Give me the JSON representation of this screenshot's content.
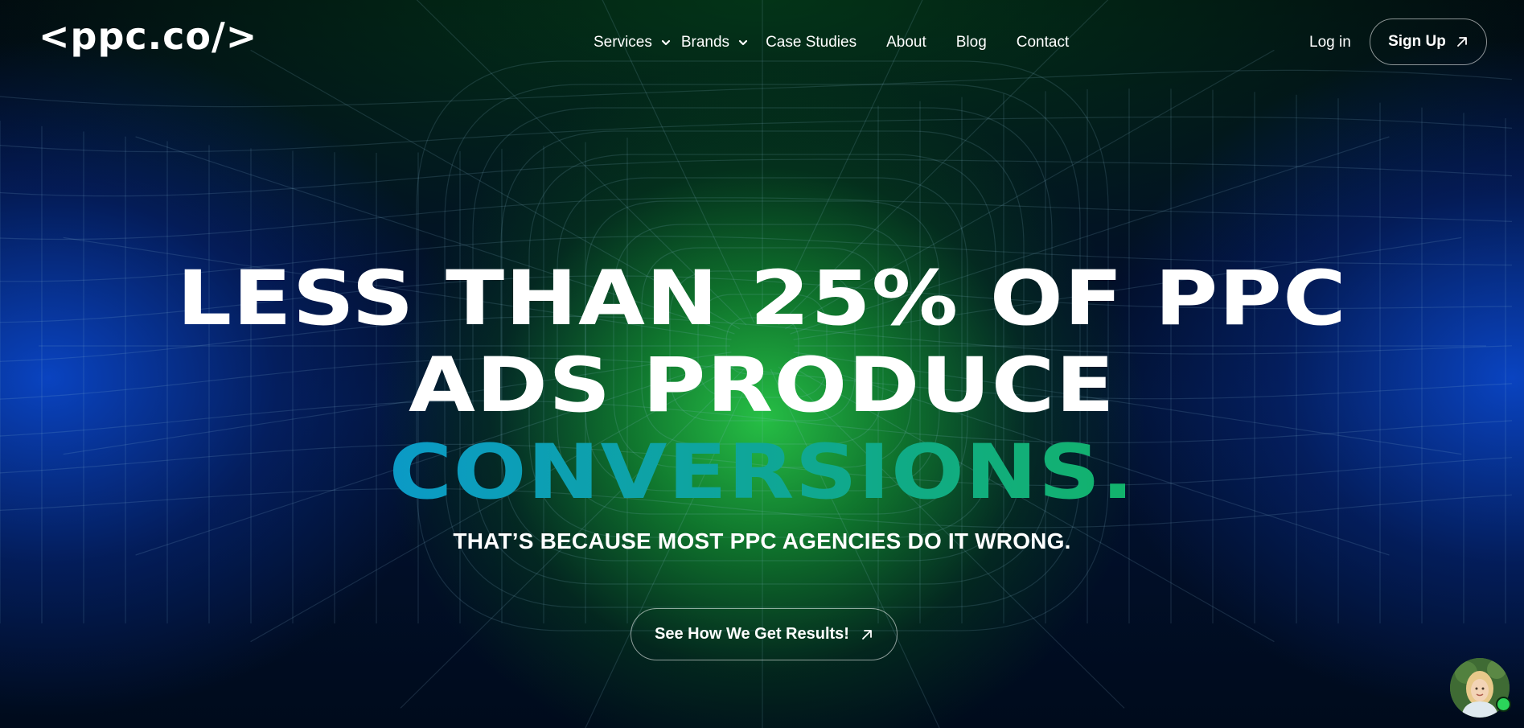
{
  "brand": {
    "logo_text": "<ppc.co/>"
  },
  "nav": {
    "items": [
      {
        "label": "Services",
        "has_dropdown": true
      },
      {
        "label": "Brands",
        "has_dropdown": true
      },
      {
        "label": "Case Studies",
        "has_dropdown": false
      },
      {
        "label": "About",
        "has_dropdown": false
      },
      {
        "label": "Blog",
        "has_dropdown": false
      },
      {
        "label": "Contact",
        "has_dropdown": false
      }
    ]
  },
  "auth": {
    "login_label": "Log in",
    "signup_label": "Sign Up",
    "signup_icon": "arrow-up-right-icon"
  },
  "hero": {
    "headline_line1": "LESS THAN 25% OF PPC",
    "headline_line2": "ADS PRODUCE",
    "headline_line3": "CONVERSIONS.",
    "subheadline": "THAT’S BECAUSE MOST PPC AGENCIES DO IT WRONG.",
    "cta_label": "See How We Get Results!",
    "cta_icon": "arrow-up-right-icon"
  },
  "chat_widget": {
    "avatar_icon": "support-agent-avatar",
    "status": "online"
  },
  "colors": {
    "background": "#000814",
    "glow_green": "#28c846",
    "glow_blue": "#0a46c8",
    "gradient_start": "#0a86e0",
    "gradient_end": "#19c24a",
    "status_online": "#2bd45a",
    "text": "#ffffff"
  }
}
